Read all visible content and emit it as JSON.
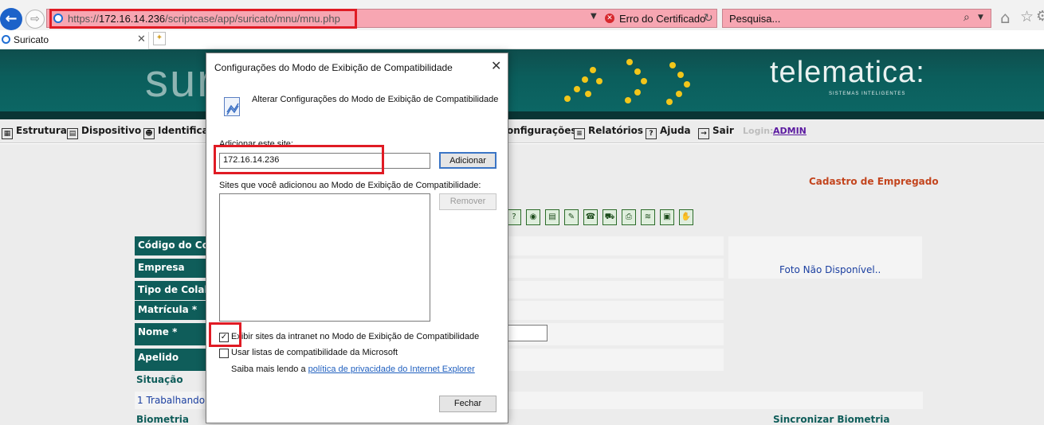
{
  "browser": {
    "url_scheme": "https://",
    "url_host": "172.16.14.236",
    "url_path": "/scriptcase/app/suricato/mnu/mnu.php",
    "cert_error": "Erro do Certificado",
    "search_placeholder": "Pesquisa...",
    "tab_title": "Suricato"
  },
  "banner": {
    "logo_text": "sur",
    "brand": "telematica:",
    "brand_tagline": "SISTEMAS INTELIGENTES"
  },
  "menu": {
    "items": [
      "Estrutura",
      "Dispositivo",
      "Identificaç",
      "onfigurações",
      "Relatórios",
      "Ajuda",
      "Sair"
    ],
    "login_label": "Login:",
    "login_user": "ADMIN"
  },
  "form": {
    "page_title": "Cadastro de Empregado",
    "labels": [
      "Código do Cola",
      "Empresa",
      "Tipo de Colabo",
      "Matrícula *",
      "Nome *",
      "Apelido"
    ],
    "photo_text": "Foto Não Disponível..",
    "situacao_label": "Situação",
    "situacao_value": "1 Trabalhando",
    "biometria_label": "Biometria",
    "sync_label": "Sincronizar Biometria"
  },
  "dialog": {
    "title": "Configurações do Modo de Exibição de Compatibilidade",
    "close_glyph": "✕",
    "header": "Alterar Configurações do Modo de Exibição de Compatibilidade",
    "add_label": "Adicionar este site:",
    "add_value": "172.16.14.236",
    "add_button": "Adicionar",
    "sites_label": "Sites que você adicionou ao Modo de Exibição de Compatibilidade:",
    "remove_button": "Remover",
    "checkbox_intranet": "Exibir sites da intranet no Modo de Exibição de Compatibilidade",
    "checkbox_intranet_checked": true,
    "checkbox_microsoft": "Usar listas de compatibilidade da Microsoft",
    "checkbox_microsoft_checked": false,
    "privacy_prefix": "Saiba mais lendo a",
    "privacy_link": "política de privacidade do Internet Explorer",
    "close_button": "Fechar"
  },
  "icons": {
    "back": "arrow-left-icon",
    "forward": "arrow-right-icon",
    "home": "home-icon",
    "favorites": "star-icon",
    "settings": "gear-icon",
    "search": "search-icon",
    "cert_error": "cert-error-icon"
  },
  "colors": {
    "banner_teal": "#0c6664",
    "highlight_red": "#e01b24",
    "error_bar_pink": "#f7a6b2",
    "page_title_orange": "#c3451e",
    "dot_yellow": "#f2c61a"
  }
}
